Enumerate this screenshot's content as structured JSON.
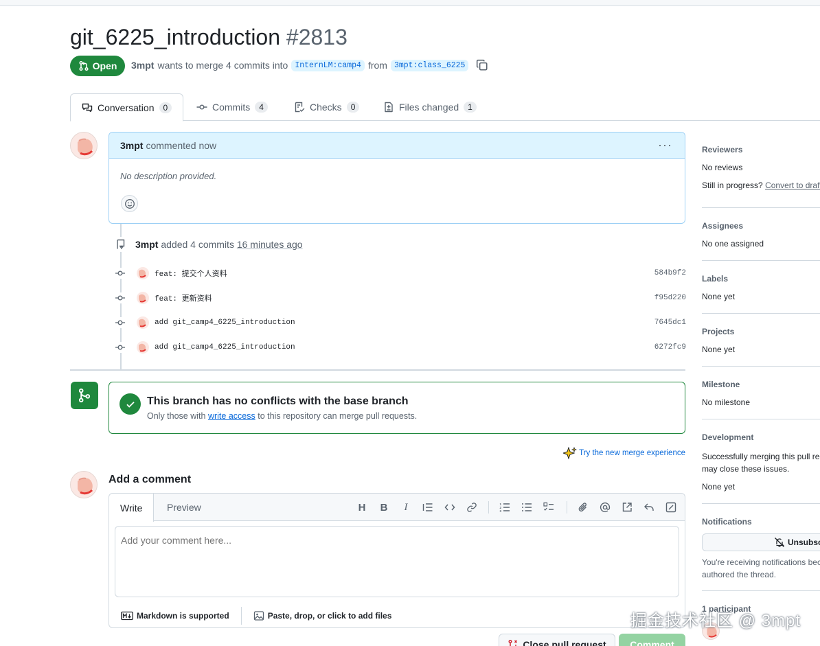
{
  "pr": {
    "title": "git_6225_introduction",
    "number": "#2813",
    "state": "Open",
    "author": "3mpt",
    "merge_text": "wants to merge 4 commits into",
    "base_branch": "InternLM:camp4",
    "from_text": "from",
    "head_branch": "3mpt:class_6225"
  },
  "tabs": [
    {
      "label": "Conversation",
      "count": "0"
    },
    {
      "label": "Commits",
      "count": "4"
    },
    {
      "label": "Checks",
      "count": "0"
    },
    {
      "label": "Files changed",
      "count": "1"
    }
  ],
  "comment": {
    "author": "3mpt",
    "action": "commented now",
    "body": "No description provided."
  },
  "event": {
    "author": "3mpt",
    "action": "added 4 commits",
    "time": "16 minutes ago"
  },
  "commits": [
    {
      "message": "feat: 提交个人资料",
      "sha": "584b9f2"
    },
    {
      "message": "feat: 更新资料",
      "sha": "f95d220"
    },
    {
      "message": "add git_camp4_6225_introduction",
      "sha": "7645dc1"
    },
    {
      "message": "add git_camp4_6225_introduction",
      "sha": "6272fc9"
    }
  ],
  "merge": {
    "title": "This branch has no conflicts with the base branch",
    "sub_before": "Only those with",
    "sub_link": "write access",
    "sub_after": "to this repository can merge pull requests.",
    "try_new": "Try the new merge experience"
  },
  "add_comment": {
    "heading": "Add a comment",
    "tab_write": "Write",
    "tab_preview": "Preview",
    "placeholder": "Add your comment here...",
    "markdown": "Markdown is supported",
    "attach": "Paste, drop, or click to add files",
    "close_button": "Close pull request",
    "comment_button": "Comment"
  },
  "sidebar": {
    "reviewers_h": "Reviewers",
    "reviewers_v": "No reviews",
    "progress": "Still in progress?",
    "convert": "Convert to draft",
    "assignees_h": "Assignees",
    "assignees_v": "No one assigned",
    "labels_h": "Labels",
    "labels_v": "None yet",
    "projects_h": "Projects",
    "projects_v": "None yet",
    "milestone_h": "Milestone",
    "milestone_v": "No milestone",
    "development_h": "Development",
    "development_v": "Successfully merging this pull request may close these issues.",
    "development_v2": "None yet",
    "notifications_h": "Notifications",
    "unsubscribe": "Unsubscribe",
    "notif_text": "You're receiving notifications because you authored the thread.",
    "participants": "1 participant"
  },
  "watermark": "掘金技术社区 @ 3mpt"
}
